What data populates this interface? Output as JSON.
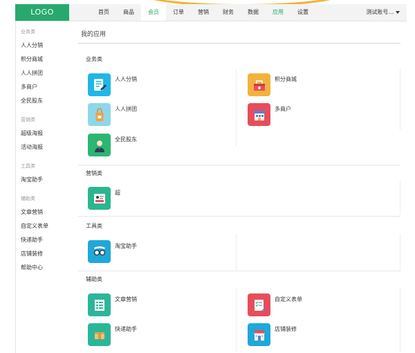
{
  "logo": "LOGO",
  "nav": [
    {
      "label": "首页"
    },
    {
      "label": "商品"
    },
    {
      "label": "会员"
    },
    {
      "label": "订单"
    },
    {
      "label": "营销"
    },
    {
      "label": "财务"
    },
    {
      "label": "数据"
    },
    {
      "label": "应用"
    },
    {
      "label": "设置"
    }
  ],
  "account": "测试账号...",
  "sidebar": {
    "groups": [
      {
        "title": "业务类",
        "items": [
          "人人分销",
          "积分商城",
          "人人拼团",
          "多商户",
          "全民股东"
        ]
      },
      {
        "title": "营销类",
        "items": [
          "超级海报",
          "活动海报"
        ]
      },
      {
        "title": "工具类",
        "items": [
          "淘宝助手"
        ]
      },
      {
        "title": "辅助类",
        "items": [
          "文章营销",
          "自定义表单",
          "快递助手",
          "店铺装修",
          "帮助中心"
        ]
      }
    ]
  },
  "page_title": "我的应用",
  "sections": [
    {
      "title": "业务类",
      "apps": [
        {
          "label": "人人分销",
          "icon": "distribution-icon",
          "color": "#1fb7e8"
        },
        {
          "label": "积分商城",
          "icon": "points-mall-icon",
          "color": "#f2b33d"
        },
        {
          "label": "人人拼团",
          "icon": "group-buy-icon",
          "color": "#8ed7ea"
        },
        {
          "label": "多商户",
          "icon": "multi-merchant-icon",
          "color": "#e84d5b"
        },
        {
          "label": "全民股东",
          "icon": "shareholder-icon",
          "color": "#2bb673"
        }
      ]
    },
    {
      "title": "营销类",
      "apps": [
        {
          "label": "超",
          "icon": "poster-icon",
          "color": "#2bb690"
        }
      ]
    },
    {
      "title": "工具类",
      "apps": [
        {
          "label": "淘宝助手",
          "icon": "taobao-glasses-icon",
          "color": "#1fa8d8"
        }
      ]
    },
    {
      "title": "辅助类",
      "apps": [
        {
          "label": "文章营销",
          "icon": "article-icon",
          "color": "#2bb69a"
        },
        {
          "label": "自定义表单",
          "icon": "custom-form-icon",
          "color": "#e84d5b"
        },
        {
          "label": "快递助手",
          "icon": "express-icon",
          "color": "#2bb69a"
        },
        {
          "label": "店铺装修",
          "icon": "store-decoration-icon",
          "color": "#1fa8d8"
        }
      ]
    }
  ]
}
